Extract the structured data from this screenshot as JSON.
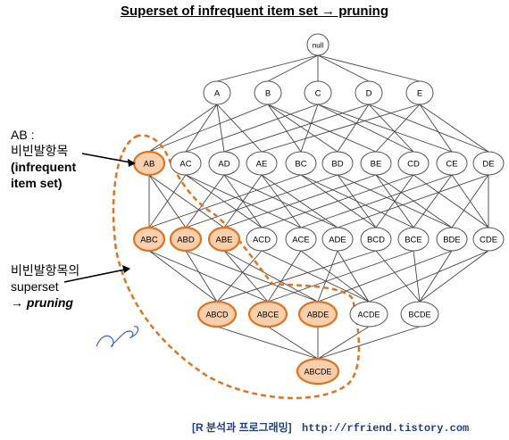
{
  "title": "Superset of infrequent item set → pruning",
  "annotation_ab": {
    "line1": "AB :",
    "line2": "비빈발항목",
    "line3": "(infrequent",
    "line4": "item set)"
  },
  "annotation_superset": {
    "line1": "비빈발항목의",
    "line2": "superset",
    "line3": "→ pruning"
  },
  "footer": {
    "blog": "[R 분석과 프로그래밍]",
    "url": "http://rfriend.tistory.com"
  },
  "colors": {
    "pruned_fill": "#f9cfae",
    "pruned_stroke": "#e07320",
    "normal_fill": "#ffffff",
    "normal_stroke": "#555555",
    "dashed_boundary": "#e07320",
    "footer": "#1f3f82"
  },
  "lattice": {
    "levels": [
      [
        "null"
      ],
      [
        "A",
        "B",
        "C",
        "D",
        "E"
      ],
      [
        "AB",
        "AC",
        "AD",
        "AE",
        "BC",
        "BD",
        "BE",
        "CD",
        "CE",
        "DE"
      ],
      [
        "ABC",
        "ABD",
        "ABE",
        "ACD",
        "ACE",
        "ADE",
        "BCD",
        "BCE",
        "BDE",
        "CDE"
      ],
      [
        "ABCD",
        "ABCE",
        "ABDE",
        "ACDE",
        "BCDE"
      ],
      [
        "ABCDE"
      ]
    ],
    "pruned": [
      "AB",
      "ABC",
      "ABD",
      "ABE",
      "ABCD",
      "ABCE",
      "ABDE",
      "ABCDE"
    ]
  }
}
